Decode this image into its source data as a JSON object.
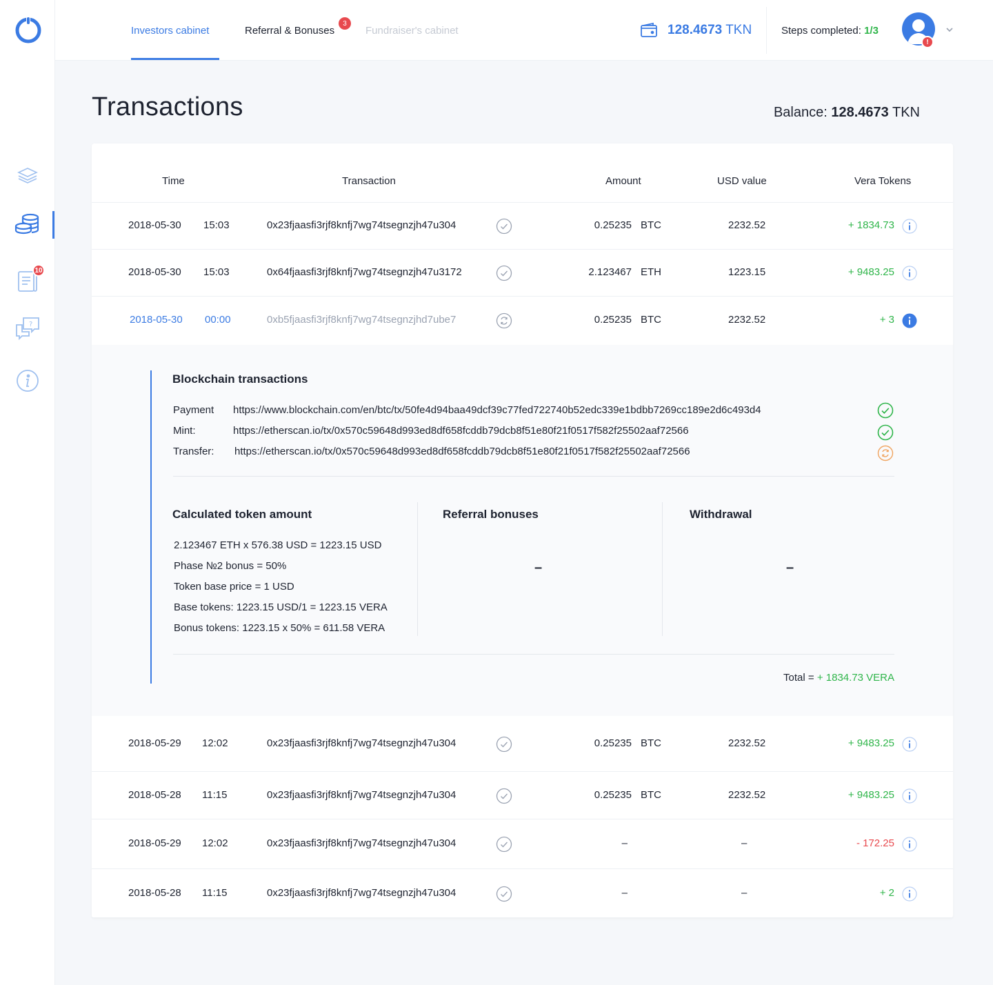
{
  "header": {
    "tabs": [
      {
        "label": "Investors cabinet"
      },
      {
        "label": "Referral & Bonuses",
        "badge": "3"
      },
      {
        "label": "Fundraiser's cabinet"
      }
    ],
    "wallet_value": "128.4673",
    "wallet_unit": "TKN",
    "steps_label": "Steps completed:",
    "steps_value": "1/3"
  },
  "sidebar": {
    "items": [
      {
        "icon": "layers-icon"
      },
      {
        "icon": "coins-icon"
      },
      {
        "icon": "document-icon",
        "badge": "10"
      },
      {
        "icon": "chat-help-icon"
      },
      {
        "icon": "info-icon"
      }
    ]
  },
  "page": {
    "title": "Transactions",
    "balance_label": "Balance:",
    "balance_value": "128.4673",
    "balance_unit": "TKN"
  },
  "table": {
    "columns": [
      "Time",
      "Transaction",
      "Amount",
      "USD value",
      "Vera Tokens"
    ],
    "rows": [
      {
        "date": "2018-05-30",
        "time": "15:03",
        "hash": "0x23fjaasfi3rjf8knfj7wg74tsegnzjh47u304",
        "status": "confirmed",
        "amount": "0.25235",
        "currency": "BTC",
        "usd": "2232.52",
        "tokens": "+ 1834.73",
        "sign": "plus"
      },
      {
        "date": "2018-05-30",
        "time": "15:03",
        "hash": "0x64fjaasfi3rjf8knfj7wg74tsegnzjh47u3172",
        "status": "confirmed",
        "amount": "2.123467",
        "currency": "ETH",
        "usd": "1223.15",
        "tokens": "+ 9483.25",
        "sign": "plus"
      },
      {
        "date": "2018-05-30",
        "time": "00:00",
        "hash": "0xb5fjaasfi3rjf8knfj7wg74tsegnzjhd7ube7",
        "status": "pending",
        "amount": "0.25235",
        "currency": "BTC",
        "usd": "2232.52",
        "tokens": "+ 3",
        "sign": "plus"
      },
      {
        "date": "2018-05-29",
        "time": "12:02",
        "hash": "0x23fjaasfi3rjf8knfj7wg74tsegnzjh47u304",
        "status": "confirmed",
        "amount": "0.25235",
        "currency": "BTC",
        "usd": "2232.52",
        "tokens": "+ 9483.25",
        "sign": "plus"
      },
      {
        "date": "2018-05-28",
        "time": "11:15",
        "hash": "0x23fjaasfi3rjf8knfj7wg74tsegnzjh47u304",
        "status": "confirmed",
        "amount": "0.25235",
        "currency": "BTC",
        "usd": "2232.52",
        "tokens": "+ 9483.25",
        "sign": "plus"
      },
      {
        "date": "2018-05-29",
        "time": "12:02",
        "hash": "0x23fjaasfi3rjf8knfj7wg74tsegnzjh47u304",
        "status": "confirmed",
        "amount": "–",
        "currency": "",
        "usd": "–",
        "tokens": "- 172.25",
        "sign": "minus"
      },
      {
        "date": "2018-05-28",
        "time": "11:15",
        "hash": "0x23fjaasfi3rjf8knfj7wg74tsegnzjh47u304",
        "status": "confirmed",
        "amount": "–",
        "currency": "",
        "usd": "–",
        "tokens": "+ 2",
        "sign": "plus"
      }
    ]
  },
  "detail": {
    "blockchain_title": "Blockchain transactions",
    "links": [
      {
        "label": "Payment",
        "url": "https://www.blockchain.com/en/btc/tx/50fe4d94baa49dcf39c77fed722740b52edc339e1bdbb7269cc189e2d6c493d4",
        "status": "confirmed"
      },
      {
        "label": "Mint:",
        "url": "https://etherscan.io/tx/0x570c59648d993ed8df658fcddb79dcb8f51e80f21f0517f582f25502aaf72566",
        "status": "confirmed"
      },
      {
        "label": "Transfer:",
        "url": "https://etherscan.io/tx/0x570c59648d993ed8df658fcddb79dcb8f51e80f21f0517f582f25502aaf72566",
        "status": "pending"
      }
    ],
    "calc_title": "Calculated token amount",
    "calc_lines": [
      "2.123467 ETH x 576.38 USD = 1223.15 USD",
      "Phase №2 bonus = 50%",
      "Token base price = 1 USD",
      "Base tokens: 1223.15 USD/1 = 1223.15 VERA",
      "Bonus tokens: 1223.15 x 50% = 611.58 VERA"
    ],
    "referral_title": "Referral bonuses",
    "referral_value": "–",
    "withdrawal_title": "Withdrawal",
    "withdrawal_value": "–",
    "total_label": "Total =",
    "total_value": "+ 1834.73 VERA"
  },
  "colors": {
    "accent": "#3b7be3",
    "positive": "#2fb54a",
    "negative": "#e8494e",
    "pending": "#f0a35e"
  }
}
